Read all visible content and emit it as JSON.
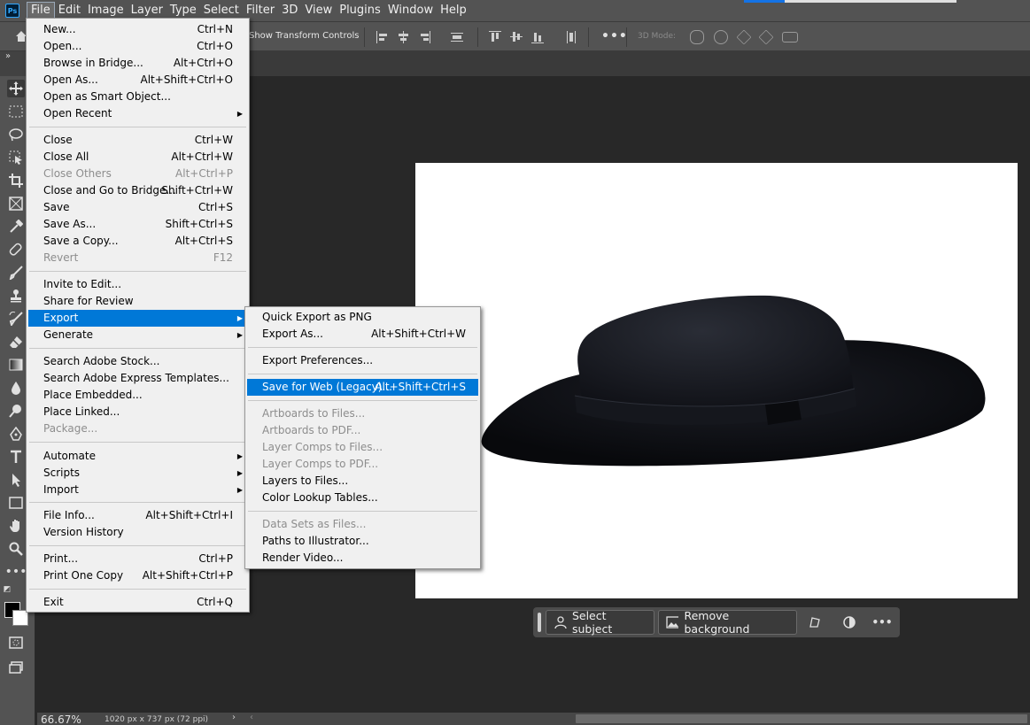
{
  "app": {
    "logo": "Ps",
    "menubar": [
      "File",
      "Edit",
      "Image",
      "Layer",
      "Type",
      "Select",
      "Filter",
      "3D",
      "View",
      "Plugins",
      "Window",
      "Help"
    ],
    "active_menu": "File"
  },
  "options_bar": {
    "show_transform_controls": "Show Transform Controls",
    "more": "•••",
    "mode_3d": "3D Mode:"
  },
  "file_menu": {
    "items": [
      {
        "label": "New...",
        "shortcut": "Ctrl+N"
      },
      {
        "label": "Open...",
        "shortcut": "Ctrl+O"
      },
      {
        "label": "Browse in Bridge...",
        "shortcut": "Alt+Ctrl+O"
      },
      {
        "label": "Open As...",
        "shortcut": "Alt+Shift+Ctrl+O"
      },
      {
        "label": "Open as Smart Object...",
        "shortcut": ""
      },
      {
        "label": "Open Recent",
        "shortcut": ""
      },
      {
        "label": "Close",
        "shortcut": "Ctrl+W"
      },
      {
        "label": "Close All",
        "shortcut": "Alt+Ctrl+W"
      },
      {
        "label": "Close Others",
        "shortcut": "Alt+Ctrl+P"
      },
      {
        "label": "Close and Go to Bridge...",
        "shortcut": "Shift+Ctrl+W"
      },
      {
        "label": "Save",
        "shortcut": "Ctrl+S"
      },
      {
        "label": "Save As...",
        "shortcut": "Shift+Ctrl+S"
      },
      {
        "label": "Save a Copy...",
        "shortcut": "Alt+Ctrl+S"
      },
      {
        "label": "Revert",
        "shortcut": "F12"
      },
      {
        "label": "Invite to Edit...",
        "shortcut": ""
      },
      {
        "label": "Share for Review",
        "shortcut": ""
      },
      {
        "label": "Export",
        "shortcut": ""
      },
      {
        "label": "Generate",
        "shortcut": ""
      },
      {
        "label": "Search Adobe Stock...",
        "shortcut": ""
      },
      {
        "label": "Search Adobe Express Templates...",
        "shortcut": ""
      },
      {
        "label": "Place Embedded...",
        "shortcut": ""
      },
      {
        "label": "Place Linked...",
        "shortcut": ""
      },
      {
        "label": "Package...",
        "shortcut": ""
      },
      {
        "label": "Automate",
        "shortcut": ""
      },
      {
        "label": "Scripts",
        "shortcut": ""
      },
      {
        "label": "Import",
        "shortcut": ""
      },
      {
        "label": "File Info...",
        "shortcut": "Alt+Shift+Ctrl+I"
      },
      {
        "label": "Version History",
        "shortcut": ""
      },
      {
        "label": "Print...",
        "shortcut": "Ctrl+P"
      },
      {
        "label": "Print One Copy",
        "shortcut": "Alt+Shift+Ctrl+P"
      },
      {
        "label": "Exit",
        "shortcut": "Ctrl+Q"
      }
    ]
  },
  "export_menu": {
    "items": [
      {
        "label": "Quick Export as PNG",
        "shortcut": ""
      },
      {
        "label": "Export As...",
        "shortcut": "Alt+Shift+Ctrl+W"
      },
      {
        "label": "Export Preferences...",
        "shortcut": ""
      },
      {
        "label": "Save for Web (Legacy)...",
        "shortcut": "Alt+Shift+Ctrl+S"
      },
      {
        "label": "Artboards to Files...",
        "shortcut": ""
      },
      {
        "label": "Artboards to PDF...",
        "shortcut": ""
      },
      {
        "label": "Layer Comps to Files...",
        "shortcut": ""
      },
      {
        "label": "Layer Comps to PDF...",
        "shortcut": ""
      },
      {
        "label": "Layers to Files...",
        "shortcut": ""
      },
      {
        "label": "Color Lookup Tables...",
        "shortcut": ""
      },
      {
        "label": "Data Sets as Files...",
        "shortcut": ""
      },
      {
        "label": "Paths to Illustrator...",
        "shortcut": ""
      },
      {
        "label": "Render Video...",
        "shortcut": ""
      }
    ]
  },
  "contextual_bar": {
    "select_subject": "Select subject",
    "remove_background": "Remove background",
    "more": "•••"
  },
  "status_bar": {
    "zoom": "66.67%",
    "doc_info": "1020 px x 737 px (72 ppi)",
    "arrow": "›",
    "arrow_left": "‹"
  },
  "colors": {
    "foreground": "#000000",
    "background": "#ffffff",
    "menu_highlight": "#0078d7"
  }
}
